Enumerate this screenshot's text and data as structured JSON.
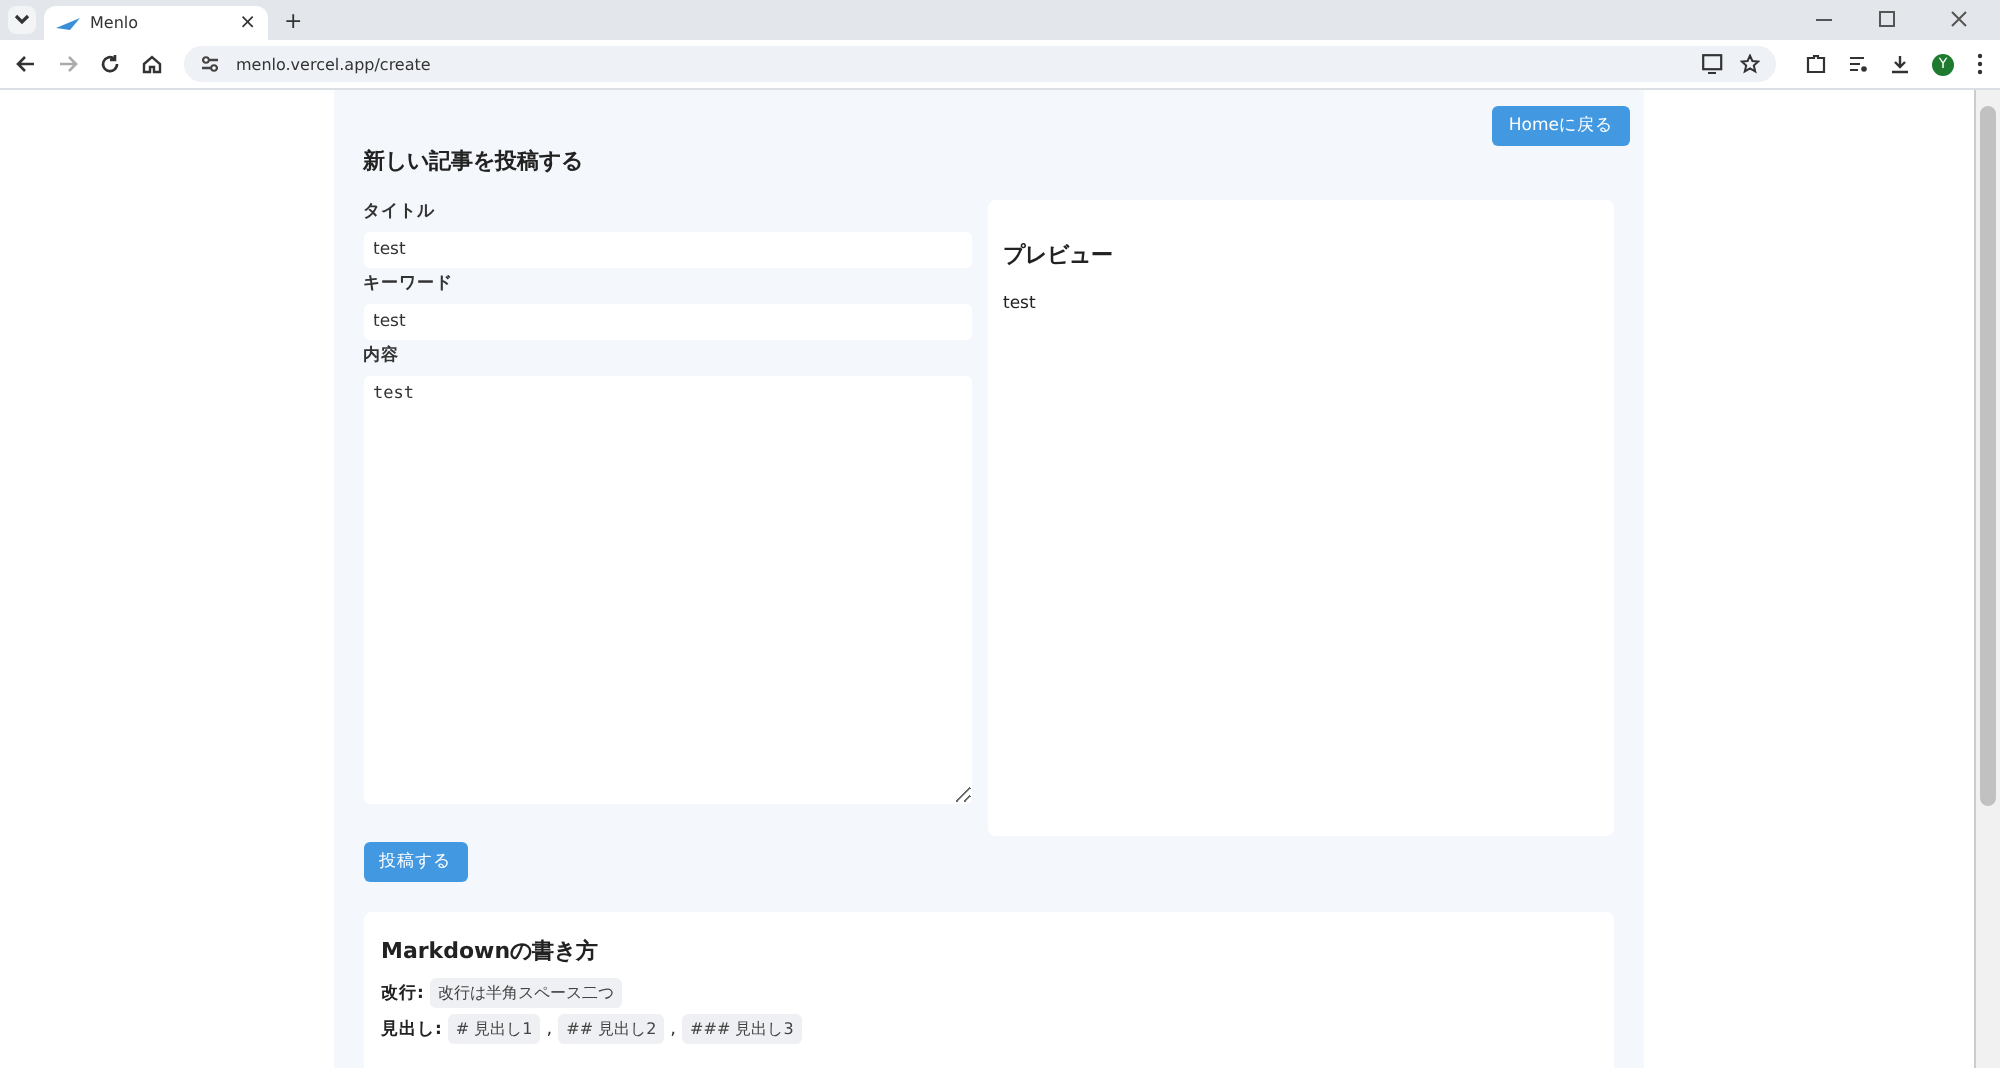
{
  "browser": {
    "tab_title": "Menlo",
    "tab_close": "×",
    "new_tab": "+",
    "url": "menlo.vercel.app/create",
    "avatar": "Y"
  },
  "page": {
    "home_button": "Homeに戻る",
    "heading": "新しい記事を投稿する",
    "fields": [
      {
        "label": "タイトル",
        "value": "test",
        "kind": "input"
      },
      {
        "label": "キーワード",
        "value": "test",
        "kind": "input"
      },
      {
        "label": "内容",
        "value": "test",
        "kind": "textarea"
      }
    ],
    "preview": {
      "title": "プレビュー",
      "body": "test"
    },
    "submit_button": "投稿する",
    "markdown": {
      "title": "Markdownの書き方",
      "rules": [
        {
          "label": "改行:",
          "examples": [
            "改行は半角スペース二つ"
          ]
        },
        {
          "label": "見出し:",
          "examples": [
            "# 見出し1",
            "## 見出し2",
            "### 見出し3"
          ],
          "separator": ","
        }
      ]
    }
  }
}
